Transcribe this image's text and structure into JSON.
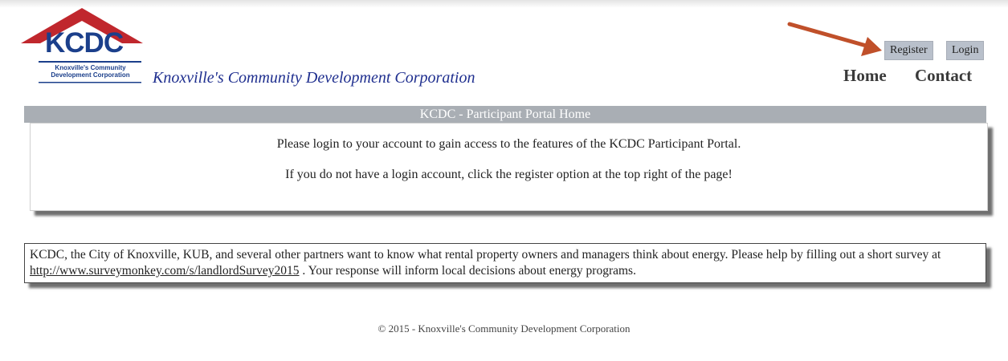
{
  "header": {
    "logo_text": "KCDC",
    "logo_sub_line1": "Knoxville's Community",
    "logo_sub_line2": "Development Corporation",
    "tagline": "Knoxville's Community Development Corporation"
  },
  "toplinks": {
    "register": "Register",
    "login": "Login"
  },
  "nav": {
    "home": "Home",
    "contact": "Contact"
  },
  "banner": {
    "title": "KCDC - Participant Portal Home"
  },
  "login_panel": {
    "line1": "Please login to your account to gain access to the features of the KCDC Participant Portal.",
    "line2": "If you do not have a login account, click the register option at the top right of the page!"
  },
  "survey_panel": {
    "text_before": "KCDC, the City of Knoxville, KUB, and several other partners want to know what rental property owners and managers think about energy. Please help by filling out a short survey at ",
    "link": "http://www.surveymonkey.com/s/landlordSurvey2015",
    "text_after": " . Your response will inform local decisions about energy programs."
  },
  "footer": {
    "copyright": "© 2015 - Knoxville's Community Development Corporation"
  },
  "colors": {
    "brand_blue": "#1b3f8b",
    "roof_red": "#c0272d",
    "arrow": "#c0502a",
    "banner_gray": "#a9aeb4"
  },
  "icons": {
    "annotation_arrow": "arrow-icon",
    "logo_roof": "house-roof-icon"
  }
}
